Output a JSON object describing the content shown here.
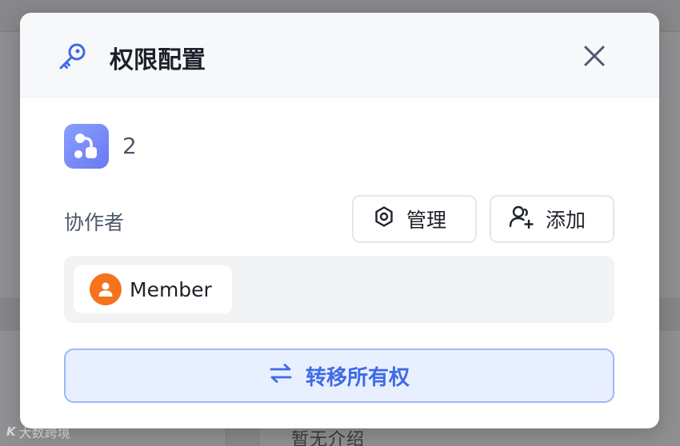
{
  "background": {
    "visible_text": "暂无介绍",
    "watermark": "大数跨境"
  },
  "modal": {
    "title": "权限配置",
    "title_icon": "key-icon",
    "close_icon": "close-icon",
    "app_icon": "app-flow-icon",
    "count": "2",
    "collaborators_label": "协作者",
    "manage_button": {
      "label": "管理",
      "icon": "gear-icon"
    },
    "add_button": {
      "label": "添加",
      "icon": "user-add-icon"
    },
    "members": [
      {
        "name": "Member",
        "icon": "user-avatar-icon",
        "avatar_color": "#f5731c"
      }
    ],
    "transfer_button": {
      "label": "转移所有权",
      "icon": "swap-arrows-icon"
    }
  },
  "colors": {
    "accent": "#3e6ae6",
    "accent_bg": "#e8efff",
    "app_icon_gradient": [
      "#8aa0ff",
      "#6a78f2"
    ]
  }
}
